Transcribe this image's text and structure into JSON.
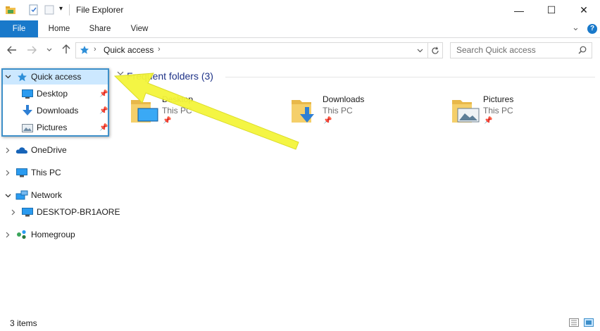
{
  "window": {
    "title": "File Explorer",
    "minimize_glyph": "—",
    "maximize_glyph": "☐",
    "close_glyph": "✕",
    "dropdown_glyph": "▾"
  },
  "ribbon": {
    "tabs": [
      "File",
      "Home",
      "Share",
      "View"
    ],
    "collapse_glyph": "⌄",
    "help_glyph": "?"
  },
  "address": {
    "breadcrumb": [
      "Quick access"
    ],
    "search_placeholder": "Search Quick access"
  },
  "nav_pane": {
    "quick_access": "Quick access",
    "pinned": [
      "Desktop",
      "Downloads",
      "Pictures"
    ],
    "onedrive": "OneDrive",
    "this_pc": "This PC",
    "network": "Network",
    "network_child": "DESKTOP-BR1AORE",
    "homegroup": "Homegroup"
  },
  "content": {
    "section_title": "Frequent folders (3)",
    "folders": [
      {
        "name": "Desktop",
        "location": "This PC",
        "icon": "desktop-folder-icon"
      },
      {
        "name": "Downloads",
        "location": "This PC",
        "icon": "downloads-folder-icon"
      },
      {
        "name": "Pictures",
        "location": "This PC",
        "icon": "pictures-folder-icon"
      }
    ]
  },
  "status": {
    "item_count": "3 items"
  },
  "colors": {
    "accent": "#1979ca",
    "selection": "#cce8ff",
    "section_title": "#1e3287",
    "annotation_arrow": "#f4f53a"
  }
}
